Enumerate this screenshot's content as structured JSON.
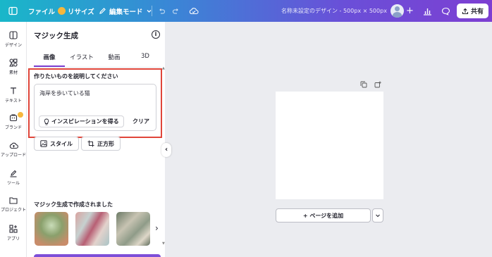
{
  "topbar": {
    "file_label": "ファイル",
    "resize_label": "リサイズ",
    "edit_mode_label": "編集モード",
    "design_title": "名称未設定のデザイン - 500px × 500px",
    "share_label": "共有"
  },
  "rail": {
    "items": [
      {
        "label": "デザイン",
        "icon": "layout-icon"
      },
      {
        "label": "素材",
        "icon": "elements-icon"
      },
      {
        "label": "テキスト",
        "icon": "text-icon"
      },
      {
        "label": "ブランド",
        "icon": "brand-icon"
      },
      {
        "label": "アップロード",
        "icon": "upload-icon"
      },
      {
        "label": "ツール",
        "icon": "draw-icon"
      },
      {
        "label": "プロジェクト",
        "icon": "folder-icon"
      },
      {
        "label": "アプリ",
        "icon": "apps-icon"
      }
    ]
  },
  "panel": {
    "title": "マジック生成",
    "tabs": [
      "画像",
      "イラスト",
      "動画",
      "3D"
    ],
    "active_tab": "画像",
    "prompt_label": "作りたいものを説明してください",
    "prompt_value": "海岸を歩いている猫",
    "inspiration_label": "インスピレーションを得る",
    "clear_label": "クリア",
    "style_label": "スタイル",
    "aspect_label": "正方形",
    "gallery_title": "マジック生成で作成されました"
  },
  "canvas": {
    "add_page_label": "+ ページを追加"
  },
  "colors": {
    "accent": "#7d3fd2",
    "highlight": "#e0453a"
  }
}
